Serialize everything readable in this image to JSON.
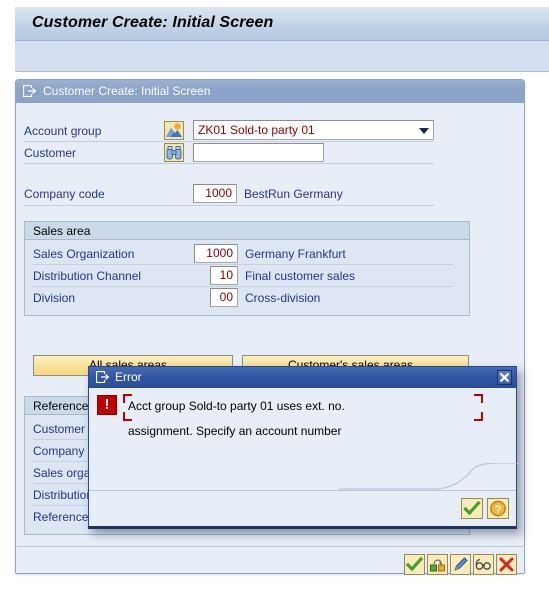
{
  "app": {
    "title": "Customer Create: Initial Screen"
  },
  "panel": {
    "title": "Customer Create: Initial Screen",
    "title_icon": "export-icon"
  },
  "form": {
    "account_group": {
      "label": "Account group",
      "icon": "possible-entries-icon",
      "value": "ZK01 Sold-to party 01"
    },
    "customer": {
      "label": "Customer",
      "icon": "binoculars-search-icon",
      "value": "",
      "placeholder": ""
    },
    "company_code": {
      "label": "Company code",
      "value": "1000",
      "description": "BestRun Germany"
    }
  },
  "sales_area": {
    "title": "Sales area",
    "rows": [
      {
        "label": "Sales Organization",
        "value": "1000",
        "description": "Germany Frankfurt"
      },
      {
        "label": "Distribution Channel",
        "value": "10",
        "description": "Final customer sales"
      },
      {
        "label": "Division",
        "value": "00",
        "description": "Cross-division"
      }
    ],
    "buttons": [
      {
        "label": "All sales areas..."
      },
      {
        "label": "Customer's sales areas..."
      }
    ]
  },
  "reference": {
    "title": "Reference",
    "rows": [
      {
        "label": "Customer"
      },
      {
        "label": "Company c"
      },
      {
        "label": "Sales orga"
      },
      {
        "label": "Distribution"
      },
      {
        "label": "Reference"
      }
    ]
  },
  "panel_toolbar": {
    "buttons": [
      {
        "name": "continue-button",
        "icon": "green-check-icon"
      },
      {
        "name": "create-with-reference-button",
        "icon": "copy-reference-icon"
      },
      {
        "name": "change-button",
        "icon": "pencil-edit-icon"
      },
      {
        "name": "display-button",
        "icon": "glasses-display-icon"
      },
      {
        "name": "cancel-button",
        "icon": "red-x-icon"
      }
    ]
  },
  "error_dialog": {
    "title": "Error",
    "icon": "export-icon",
    "close_icon": "close-icon",
    "message_icon": "error-exclamation-icon",
    "message_lines": [
      "Acct group Sold-to party 01 uses ext. no.",
      "assignment. Specify an account number"
    ],
    "buttons": [
      {
        "name": "dialog-continue-button",
        "icon": "green-check-icon"
      },
      {
        "name": "dialog-help-button",
        "icon": "question-help-icon"
      }
    ]
  },
  "colors": {
    "accent_blue": "#26348c",
    "value_red": "#8b0000",
    "error_red": "#c00000",
    "titlebar_blue": "#2f53a0",
    "panel_title_blue": "#8ba3c7",
    "button_yellow": "#f8e49c"
  }
}
